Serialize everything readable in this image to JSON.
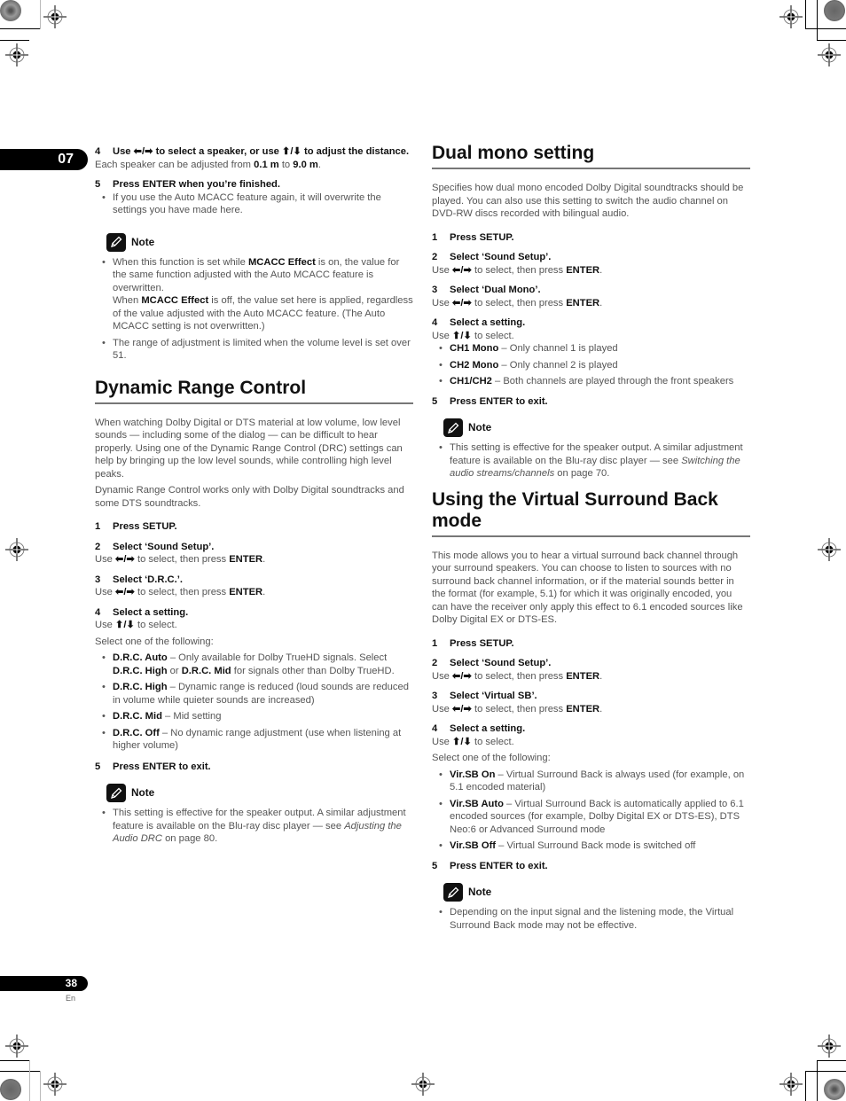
{
  "page": {
    "chapter": "07",
    "page_number": "38",
    "language": "En"
  },
  "left": {
    "step4": {
      "num": "4",
      "text_a": "Use ",
      "arrows_lr": "⬅/➡",
      "text_b": " to select a speaker, or use ",
      "arrows_ud": "⬆/⬇",
      "text_c": " to adjust the distance."
    },
    "step4_body": {
      "a": "Each speaker can be adjusted from ",
      "b": "0.1 m",
      "c": " to ",
      "d": "9.0 m",
      "e": "."
    },
    "step5": {
      "num": "5",
      "text": "Press ENTER when you’re finished."
    },
    "step5_bullet": "If you use the Auto MCACC feature again, it will overwrite the settings you have made here.",
    "note1": {
      "label": "Note",
      "b1": {
        "a": "When this function is set while ",
        "b": "MCACC Effect",
        "c": " is on, the value for the same function adjusted with the Auto MCACC feature is overwritten.",
        "d": "When ",
        "e": "MCACC Effect",
        "f": " is off, the value set here is applied, regardless of the value adjusted with the Auto MCACC feature. (The Auto MCACC setting is not overwritten.)"
      },
      "b2": "The range of adjustment is limited when the volume level is set over 51."
    },
    "drc": {
      "title": "Dynamic Range Control",
      "p1": "When watching Dolby Digital or DTS material at low volume, low level sounds — including some of the dialog — can be difficult to hear properly. Using one of the Dynamic Range Control (DRC) settings can help by bringing up the low level sounds, while controlling high level peaks.",
      "p2": "Dynamic Range Control works only with Dolby Digital soundtracks and some DTS soundtracks.",
      "s1": {
        "num": "1",
        "text": "Press SETUP."
      },
      "s2": {
        "num": "2",
        "text": "Select ‘Sound Setup’."
      },
      "s2_body": {
        "a": "Use ",
        "arrows": "⬅/➡",
        "b": " to select, then press ",
        "c": "ENTER",
        "d": "."
      },
      "s3": {
        "num": "3",
        "text": "Select ‘D.R.C.’."
      },
      "s3_body": {
        "a": "Use ",
        "arrows": "⬅/➡",
        "b": " to select, then press ",
        "c": "ENTER",
        "d": "."
      },
      "s4": {
        "num": "4",
        "text": "Select a setting."
      },
      "s4_body": {
        "a": "Use ",
        "arrows": "⬆/⬇",
        "b": " to select."
      },
      "s4_intro": "Select one of the following:",
      "options": [
        {
          "name": "D.R.C. Auto",
          "desc_a": " – Only available for Dolby TrueHD signals. Select ",
          "b1": "D.R.C. High",
          "or": " or ",
          "b2": "D.R.C. Mid",
          "desc_b": " for signals other than Dolby TrueHD."
        },
        {
          "name": "D.R.C. High",
          "desc": " – Dynamic range is reduced (loud sounds are reduced in volume while quieter sounds are increased)"
        },
        {
          "name": "D.R.C. Mid",
          "desc": " – Mid setting"
        },
        {
          "name": "D.R.C. Off",
          "desc": " – No dynamic range adjustment (use when listening at higher volume)"
        }
      ],
      "s5": {
        "num": "5",
        "text": "Press ENTER to exit."
      },
      "note": {
        "label": "Note",
        "a": "This setting is effective for the speaker output. A similar adjustment feature is available on the Blu-ray disc player — see ",
        "link": "Adjusting the Audio DRC",
        "b": " on page 80."
      }
    }
  },
  "right": {
    "dual": {
      "title": "Dual mono setting",
      "p1": "Specifies how dual mono encoded Dolby Digital soundtracks should be played. You can also use this setting to switch the audio channel on DVD-RW discs recorded with bilingual audio.",
      "s1": {
        "num": "1",
        "text": "Press SETUP."
      },
      "s2": {
        "num": "2",
        "text": "Select ‘Sound Setup’."
      },
      "s2_body": {
        "a": "Use ",
        "arrows": "⬅/➡",
        "b": " to select, then press ",
        "c": "ENTER",
        "d": "."
      },
      "s3": {
        "num": "3",
        "text": "Select ‘Dual Mono’."
      },
      "s3_body": {
        "a": "Use ",
        "arrows": "⬅/➡",
        "b": " to select, then press ",
        "c": "ENTER",
        "d": "."
      },
      "s4": {
        "num": "4",
        "text": "Select a setting."
      },
      "s4_body": {
        "a": "Use ",
        "arrows": "⬆/⬇",
        "b": " to select."
      },
      "options": [
        {
          "name": "CH1 Mono",
          "desc": " – Only channel 1 is played"
        },
        {
          "name": "CH2 Mono",
          "desc": " – Only channel 2 is played"
        },
        {
          "name": "CH1/CH2",
          "desc": " – Both channels are played through the front speakers"
        }
      ],
      "s5": {
        "num": "5",
        "text": "Press ENTER to exit."
      },
      "note": {
        "label": "Note",
        "a": "This setting is effective for the speaker output. A similar adjustment feature is available on the Blu-ray disc player — see ",
        "link": "Switching the audio streams/channels",
        "b": " on page 70."
      }
    },
    "vsb": {
      "title": "Using the Virtual Surround Back mode",
      "p1": "This mode allows you to hear a virtual surround back channel through your surround speakers. You can choose to listen to sources with no surround back channel information, or if the material sounds better in the format (for example, 5.1) for which it was originally encoded, you can have the receiver only apply this effect to 6.1 encoded sources like Dolby Digital EX or DTS-ES.",
      "s1": {
        "num": "1",
        "text": "Press SETUP."
      },
      "s2": {
        "num": "2",
        "text": "Select ‘Sound Setup’."
      },
      "s2_body": {
        "a": "Use ",
        "arrows": "⬅/➡",
        "b": " to select, then press ",
        "c": "ENTER",
        "d": "."
      },
      "s3": {
        "num": "3",
        "text": "Select ‘Virtual SB’."
      },
      "s3_body": {
        "a": "Use ",
        "arrows": "⬅/➡",
        "b": " to select, then press ",
        "c": "ENTER",
        "d": "."
      },
      "s4": {
        "num": "4",
        "text": "Select a setting."
      },
      "s4_body": {
        "a": "Use ",
        "arrows": "⬆/⬇",
        "b": " to select."
      },
      "s4_intro": "Select one of the following:",
      "options": [
        {
          "name": "Vir.SB On",
          "desc": " – Virtual Surround Back is always used (for example, on 5.1 encoded material)"
        },
        {
          "name": "Vir.SB Auto",
          "desc": " – Virtual Surround Back is automatically applied to 6.1 encoded sources (for example, Dolby Digital EX or DTS-ES), DTS Neo:6 or Advanced Surround mode"
        },
        {
          "name": "Vir.SB Off",
          "desc": " – Virtual Surround Back mode is switched off"
        }
      ],
      "s5": {
        "num": "5",
        "text": "Press ENTER to exit."
      },
      "note": {
        "label": "Note",
        "text": "Depending on the input signal and the listening mode, the Virtual Surround Back mode may not be effective."
      }
    }
  }
}
